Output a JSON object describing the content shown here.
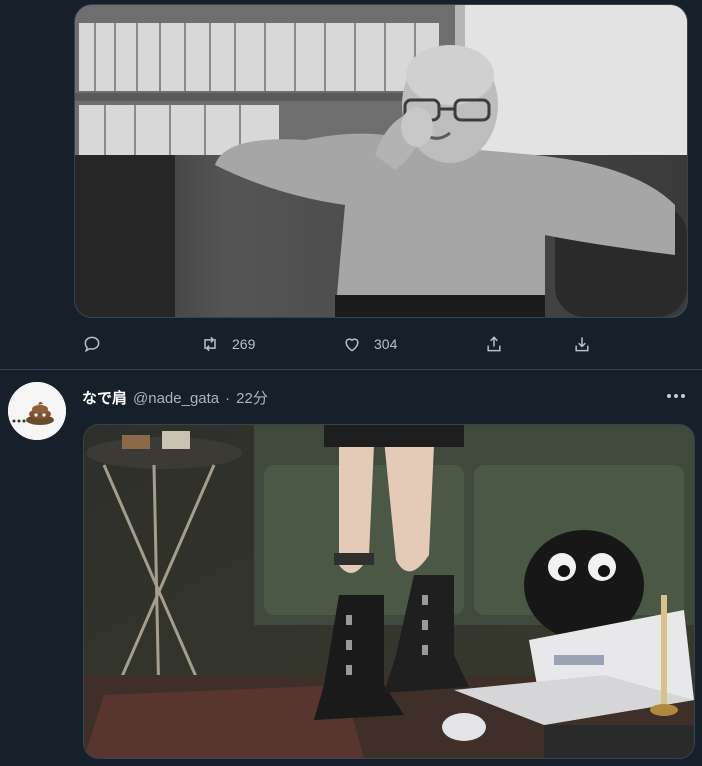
{
  "tweet_1": {
    "media": {
      "description_icon": "photo"
    },
    "actions": {
      "retweets": "269",
      "likes": "304"
    }
  },
  "tweet_2": {
    "display_name": "なで肩",
    "handle": "@nade_gata",
    "separator": "·",
    "time": "22分",
    "avatar_icon": "poop-emoji-icon"
  },
  "colors": {
    "background": "#15202b",
    "divider": "#38444d",
    "icon": "#b7c0c9"
  }
}
